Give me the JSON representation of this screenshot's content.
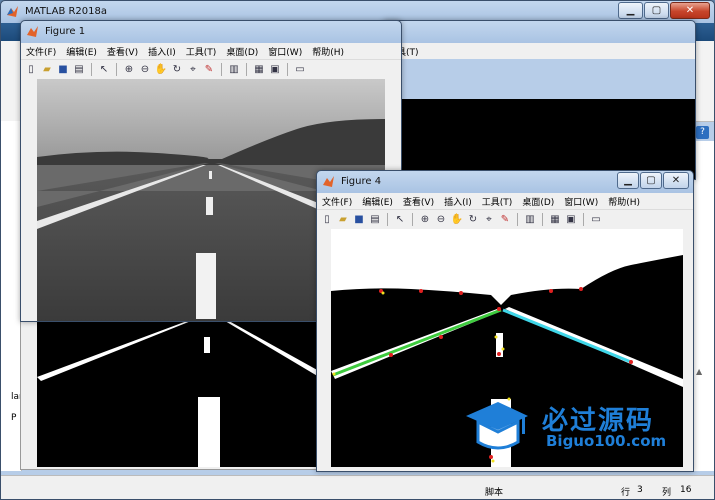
{
  "matlab": {
    "title": "MATLAB R2018a"
  },
  "menu": [
    "文件(F)",
    "编辑(E)",
    "查看(V)",
    "插入(I)",
    "工具(T)",
    "桌面(D)",
    "窗口(W)",
    "帮助(H)"
  ],
  "figure1": {
    "title": "Figure 1"
  },
  "figure4": {
    "title": "Figure 4"
  },
  "sidebar": {
    "lar": "lar",
    "p": "P"
  },
  "status": {
    "script": "脚本",
    "row_label": "行",
    "row": "3",
    "col_label": "列",
    "col": "16"
  },
  "watermark": {
    "cn": "必过源码",
    "en": "Biguo100.com"
  },
  "colors": {
    "titlebar": "#b7cde8",
    "lane_left": "#3ecb3e",
    "lane_right": "#3fd6e8",
    "marker_red": "#e02020",
    "marker_yellow": "#f0e020",
    "watermark": "#1f7fd8"
  },
  "toolbar_icons": [
    "new-file-icon",
    "open-icon",
    "save-icon",
    "print-icon",
    "pointer-icon",
    "zoom-in-icon",
    "zoom-out-icon",
    "pan-icon",
    "rotate-icon",
    "data-cursor-icon",
    "brush-icon",
    "colorbar-icon",
    "legend-icon",
    "hide-plot-tools-icon",
    "show-plot-tools-icon"
  ]
}
